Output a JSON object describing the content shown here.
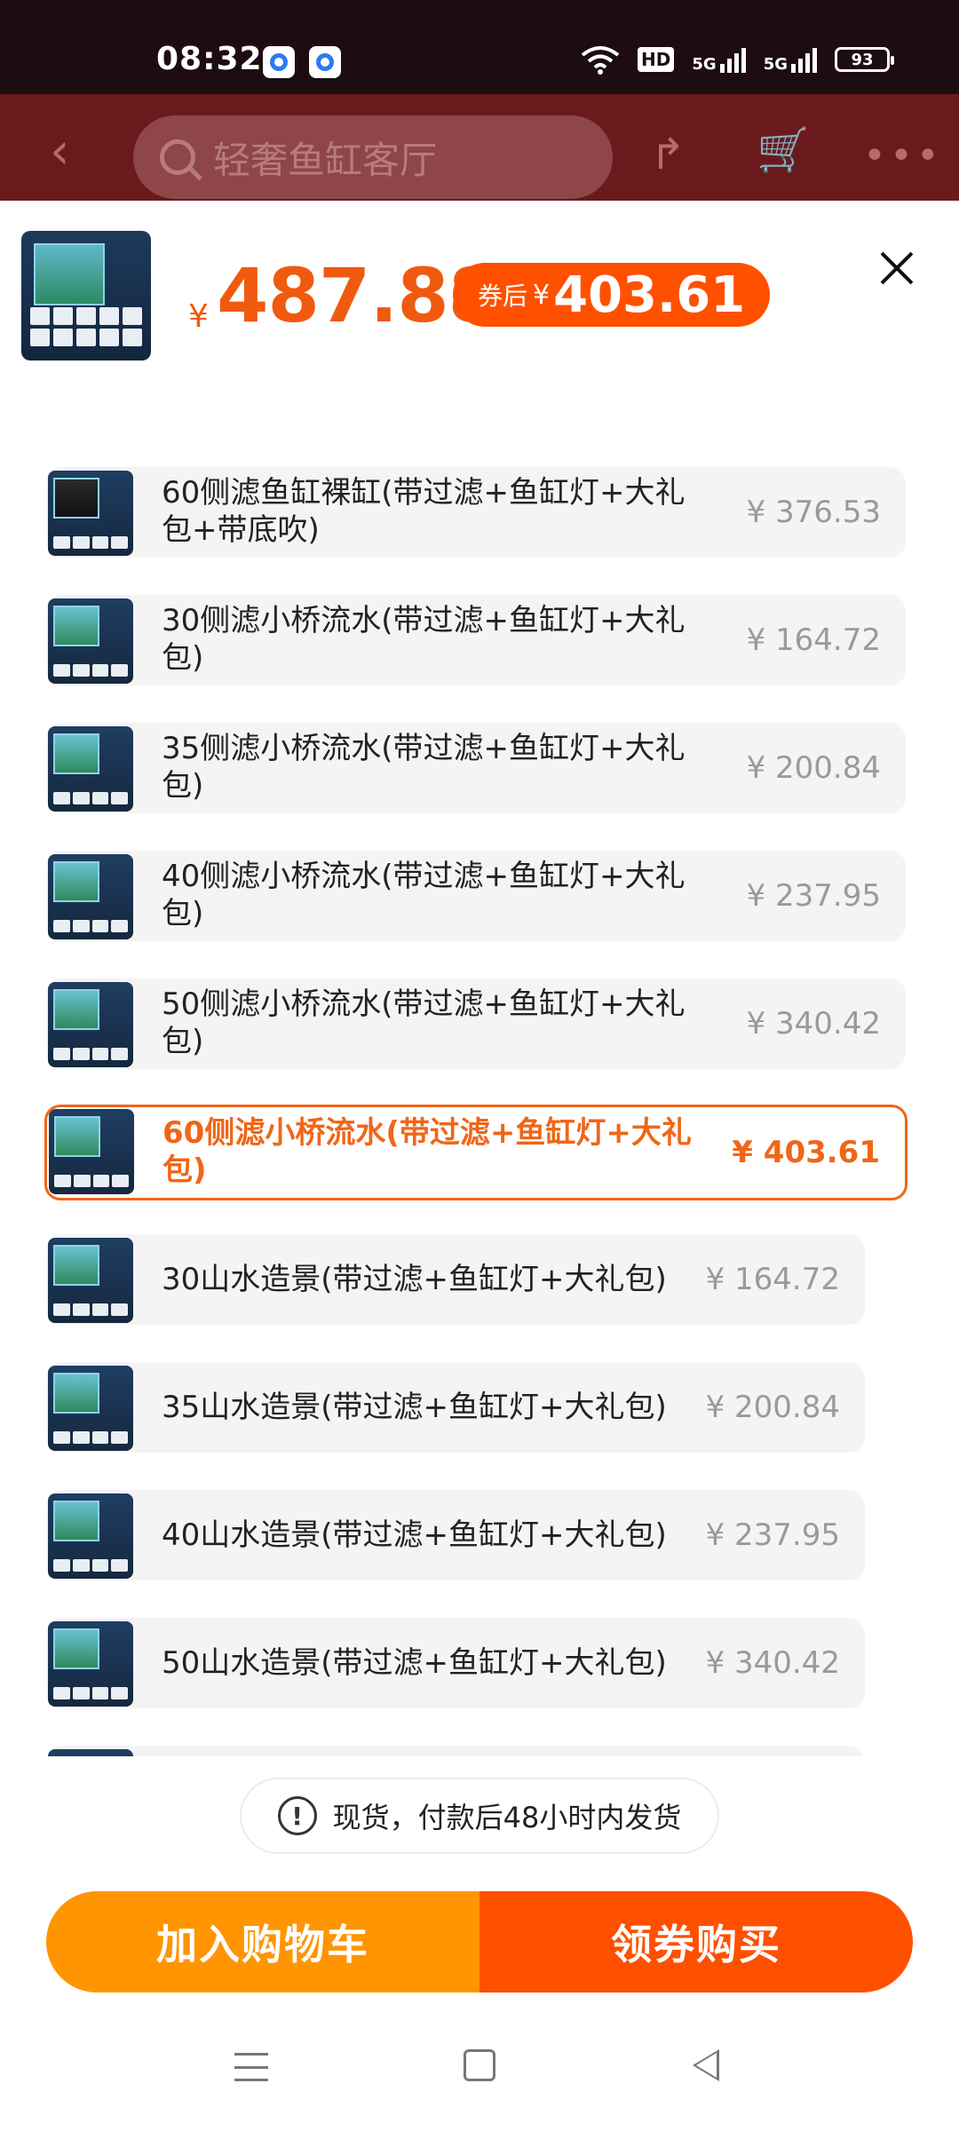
{
  "status_bar": {
    "time": "08:32",
    "hd": "HD",
    "net1": "5G",
    "net2": "5G",
    "battery": "93"
  },
  "top_nav": {
    "search_placeholder": "轻奢鱼缸客厅"
  },
  "header": {
    "currency": "¥",
    "price": "487.88",
    "coupon_label": "券后",
    "coupon_currency": "¥",
    "coupon_price": "403.61"
  },
  "options": [
    {
      "name_line1": "60侧滤鱼缸裸缸(带过滤+鱼缸灯+大礼",
      "name_line2": "包+带底吹)",
      "price": "¥ 376.53",
      "selected": false
    },
    {
      "name_line1": "30侧滤小桥流水(带过滤+鱼缸灯+大礼",
      "name_line2": "包)",
      "price": "¥ 164.72",
      "selected": false
    },
    {
      "name_line1": "35侧滤小桥流水(带过滤+鱼缸灯+大礼",
      "name_line2": "包)",
      "price": "¥ 200.84",
      "selected": false
    },
    {
      "name_line1": "40侧滤小桥流水(带过滤+鱼缸灯+大礼",
      "name_line2": "包)",
      "price": "¥ 237.95",
      "selected": false
    },
    {
      "name_line1": "50侧滤小桥流水(带过滤+鱼缸灯+大礼",
      "name_line2": "包)",
      "price": "¥ 340.42",
      "selected": false
    },
    {
      "name_line1": "60侧滤小桥流水(带过滤+鱼缸灯+大礼",
      "name_line2": "包)",
      "price": "¥ 403.61",
      "selected": true
    },
    {
      "name_line1": "30山水造景(带过滤+鱼缸灯+大礼包)",
      "name_line2": "",
      "price": "¥ 164.72",
      "selected": false
    },
    {
      "name_line1": "35山水造景(带过滤+鱼缸灯+大礼包)",
      "name_line2": "",
      "price": "¥ 200.84",
      "selected": false
    },
    {
      "name_line1": "40山水造景(带过滤+鱼缸灯+大礼包)",
      "name_line2": "",
      "price": "¥ 237.95",
      "selected": false
    },
    {
      "name_line1": "50山水造景(带过滤+鱼缸灯+大礼包)",
      "name_line2": "",
      "price": "¥ 340.42",
      "selected": false
    }
  ],
  "notice": {
    "text": "现货，付款后48小时内发货"
  },
  "actions": {
    "add_to_cart": "加入购物车",
    "buy_with_coupon": "领券购买"
  },
  "colors": {
    "accent": "#ff5000",
    "cart": "#ff9500",
    "selected_border": "#f06618"
  }
}
